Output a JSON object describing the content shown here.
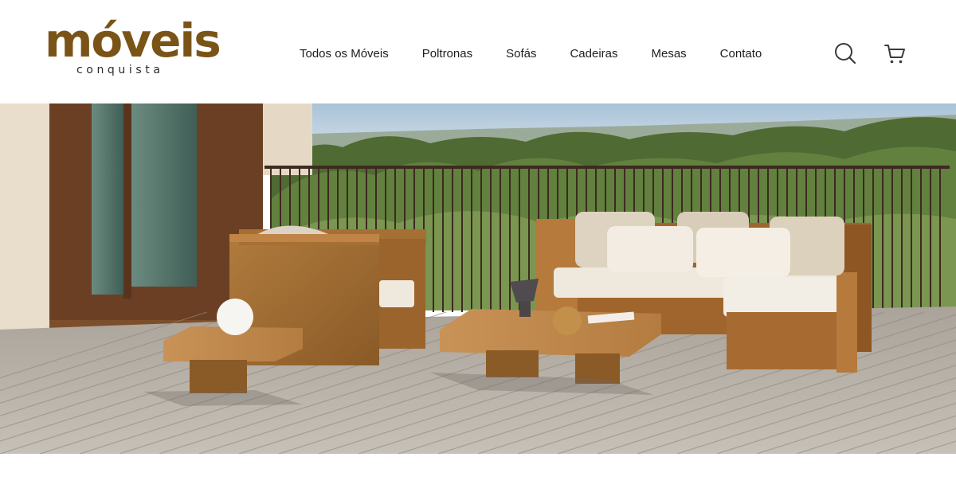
{
  "brand": {
    "name": "móveis",
    "tagline": "conquista",
    "color": "#7a5417"
  },
  "nav": {
    "items": [
      {
        "label": "Todos os Móveis"
      },
      {
        "label": "Poltronas"
      },
      {
        "label": "Sofás"
      },
      {
        "label": "Cadeiras"
      },
      {
        "label": "Mesas"
      },
      {
        "label": "Contato"
      }
    ]
  },
  "header_icons": {
    "search": "search-icon",
    "cart": "cart-icon"
  },
  "hero": {
    "image": "outdoor wooden lounge furniture set on a terrace deck"
  }
}
